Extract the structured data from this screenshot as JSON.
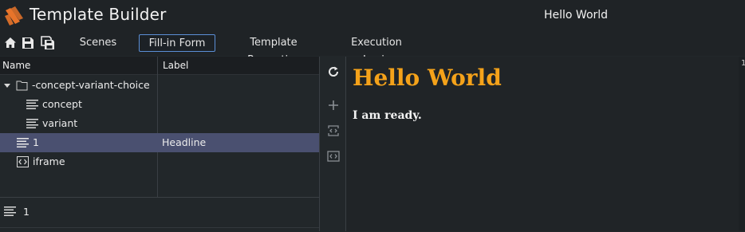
{
  "app": {
    "title": "Template Builder",
    "document_title": "Hello World",
    "logo_icon": "logo-icon"
  },
  "toolbar": {
    "icons": [
      "home-icon",
      "save-icon",
      "save-all-icon"
    ],
    "tabs": [
      {
        "label": "Scenes",
        "active": false
      },
      {
        "label": "Fill-in Form",
        "active": true
      },
      {
        "label": "Template Properties",
        "active": false
      },
      {
        "label": "Execution Logic",
        "active": false
      }
    ]
  },
  "tree": {
    "columns": {
      "name": "Name",
      "label": "Label"
    },
    "rows": [
      {
        "name": "-concept-variant-choice",
        "label": "",
        "icon": "folder-icon",
        "expander": "chevron-down-icon",
        "selected": false
      },
      {
        "name": "concept",
        "label": "",
        "icon": "list-icon",
        "selected": false
      },
      {
        "name": "variant",
        "label": "",
        "icon": "list-icon",
        "selected": false
      },
      {
        "name": "1",
        "label": "Headline",
        "icon": "list-icon",
        "selected": true
      },
      {
        "name": "iframe",
        "label": "",
        "icon": "code-icon",
        "selected": false
      }
    ]
  },
  "bottom": {
    "item_name": "1",
    "icon": "list-icon"
  },
  "side_icons": [
    "refresh-icon",
    "plus-icon",
    "insert-field-icon",
    "code-icon"
  ],
  "preview": {
    "headline": "Hello World",
    "subtext": "I am ready."
  },
  "edge": {
    "text": "1"
  },
  "colors": {
    "accent": "#f4a21a",
    "selection": "#4a5070",
    "active_tab_border": "#5b8fd6",
    "background": "#22272a"
  }
}
